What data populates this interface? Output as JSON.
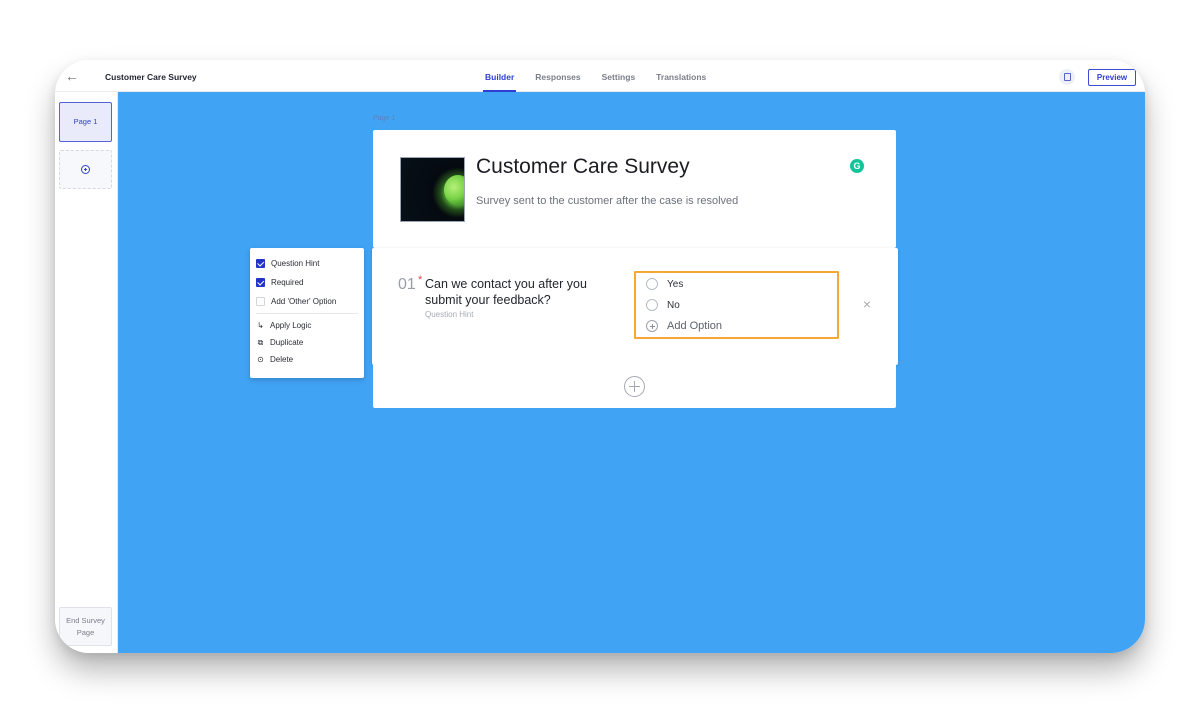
{
  "topbar": {
    "back_icon": "arrow-left-icon",
    "title": "Customer Care Survey",
    "tabs": [
      {
        "label": "Builder",
        "active": true
      },
      {
        "label": "Responses",
        "active": false
      },
      {
        "label": "Settings",
        "active": false
      },
      {
        "label": "Translations",
        "active": false
      }
    ],
    "doc_icon": "document-icon",
    "preview_label": "Preview"
  },
  "rail": {
    "pages": [
      {
        "label": "Page 1",
        "selected": true
      }
    ],
    "add_page_icon": "plus-circle-icon",
    "end_page_label": "End Survey Page"
  },
  "canvas": {
    "background_color": "#40a3f4",
    "page_label": "Page 1",
    "header": {
      "title": "Customer Care Survey",
      "description": "Survey sent to the customer after the case is resolved",
      "cover_image": "green-smiley-ball-image",
      "grammar_icon": "G"
    },
    "question": {
      "number": "01",
      "required_marker": "*",
      "text": "Can we contact you after you submit your feedback?",
      "hint": "Question Hint",
      "options": [
        {
          "label": "Yes"
        },
        {
          "label": "No"
        }
      ],
      "add_option_label": "Add Option",
      "highlight_color": "#f7a734"
    },
    "add_question_icon": "plus-circle-icon"
  },
  "settings_menu": {
    "toggles": [
      {
        "label": "Question Hint",
        "checked": true
      },
      {
        "label": "Required",
        "checked": true
      },
      {
        "label": "Add 'Other' Option",
        "checked": false
      }
    ],
    "actions": [
      {
        "label": "Apply Logic",
        "icon": "logic-icon"
      },
      {
        "label": "Duplicate",
        "icon": "duplicate-icon"
      },
      {
        "label": "Delete",
        "icon": "delete-icon"
      }
    ]
  }
}
